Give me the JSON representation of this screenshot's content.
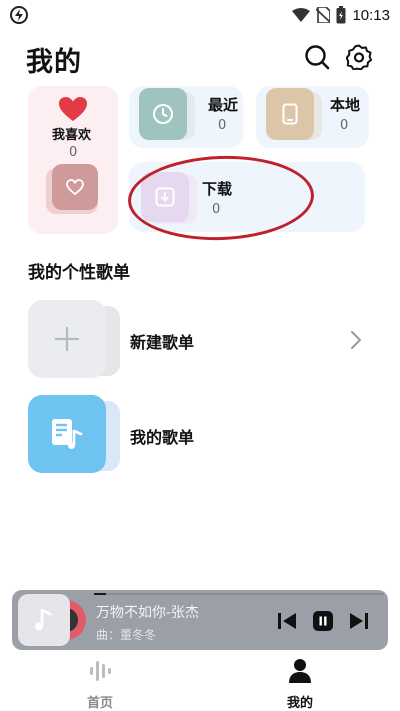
{
  "status": {
    "time": "10:13"
  },
  "header": {
    "title": "我的"
  },
  "quick_cards": {
    "favorites": {
      "label": "我喜欢",
      "count": "0"
    },
    "recent": {
      "label": "最近",
      "count": "0"
    },
    "local": {
      "label": "本地",
      "count": "0"
    },
    "downloads": {
      "label": "下载",
      "count": "0"
    }
  },
  "playlists": {
    "section_title": "我的个性歌单",
    "new_label": "新建歌单",
    "mine_label": "我的歌单"
  },
  "player": {
    "title": "万物不如你-张杰",
    "artist": "曲：董冬冬",
    "progress": 0.04
  },
  "tabs": {
    "home": "首页",
    "mine": "我的"
  },
  "colors": {
    "accent_red": "#e23a46",
    "annotation_circle": "#c0202a"
  }
}
